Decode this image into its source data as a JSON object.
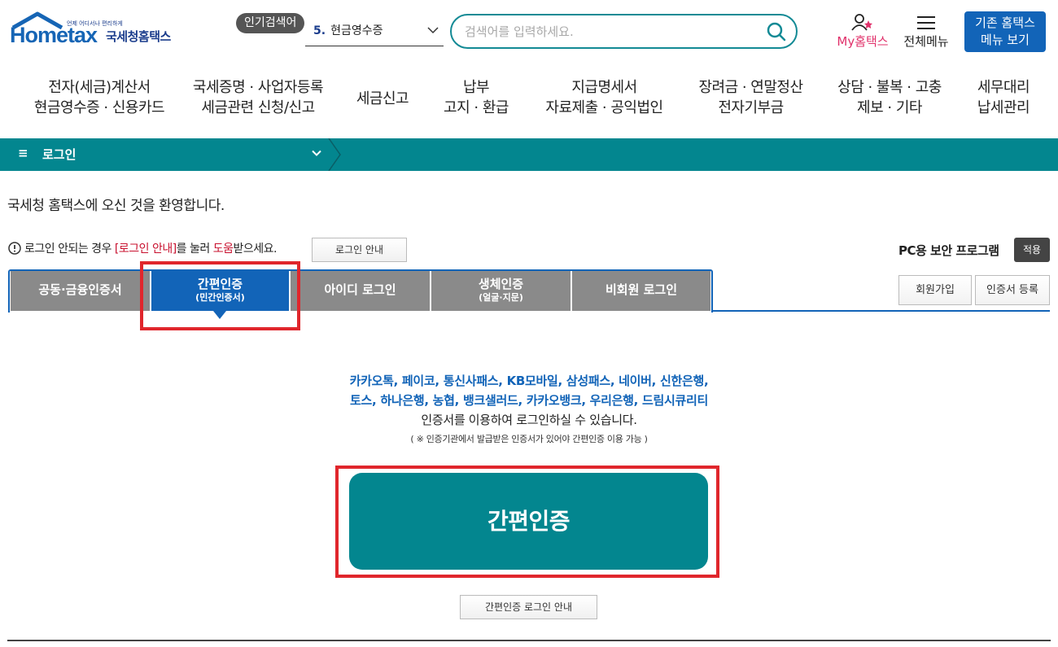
{
  "header": {
    "logo": {
      "tagline": "언제 어디서나 편리하게",
      "brand_en": "Hometax",
      "brand_ko": "국세청홈택스"
    },
    "popular": {
      "tag_label": "인기검색어",
      "rank": "5.",
      "keyword": "현금영수증"
    },
    "search": {
      "placeholder": "검색어를 입력하세요."
    },
    "my_hometax_label": "My홈택스",
    "all_menu_label": "전체메뉴",
    "old_menu_line1": "기존 홈택스",
    "old_menu_line2": "메뉴 보기"
  },
  "gnb": [
    {
      "line1": "전자(세금)계산서",
      "line2": "현금영수증 · 신용카드"
    },
    {
      "line1": "국세증명 · 사업자등록",
      "line2": "세금관련 신청/신고"
    },
    {
      "line1": "세금신고",
      "line2": ""
    },
    {
      "line1": "납부",
      "line2": "고지 · 환급"
    },
    {
      "line1": "지급명세서",
      "line2": "자료제출 · 공익법인"
    },
    {
      "line1": "장려금 · 연말정산",
      "line2": "전자기부금"
    },
    {
      "line1": "상담 · 불복 · 고충",
      "line2": "제보 · 기타"
    },
    {
      "line1": "세무대리",
      "line2": "납세관리"
    }
  ],
  "location": {
    "menu_icon_glyph": "≡",
    "label": "로그인"
  },
  "content": {
    "welcome": "국세청 홈택스에 오신 것을 환영합니다.",
    "notice_prefix": "로그인 안되는 경우 ",
    "notice_link": "[로그인 안내]",
    "notice_mid": "를 눌러 ",
    "notice_help": "도움",
    "notice_suffix": "받으세요.",
    "login_guide_button": "로그인 안내",
    "pc_security_label": "PC용 보안 프로그램",
    "apply_button": "적용"
  },
  "tabs": [
    {
      "label": "공동·금융인증서",
      "sub": ""
    },
    {
      "label": "간편인증",
      "sub": "(민간인증서)",
      "active": true
    },
    {
      "label": "아이디 로그인",
      "sub": ""
    },
    {
      "label": "생체인증",
      "sub": "(얼굴·지문)"
    },
    {
      "label": "비회원 로그인",
      "sub": ""
    }
  ],
  "side_buttons": {
    "signup": "회원가입",
    "cert_register": "인증서 등록"
  },
  "simple_auth": {
    "providers_line1": "카카오톡, 페이코, 통신사패스, KB모바일, 삼성패스, 네이버, 신한은행,",
    "providers_line2": "토스, 하나은행, 농협, 뱅크샐러드, 카카오뱅크, 우리은행, 드림시큐리티",
    "available_text": "인증서를 이용하여 로그인하실 수 있습니다.",
    "note": "( ※ 인증기관에서 발급받은 인증서가 있어야 간편인증 이용 가능 )",
    "main_button": "간편인증",
    "guide_button": "간편인증 로그인 안내"
  },
  "colors": {
    "primary_blue": "#1264b8",
    "teal": "#03868f",
    "highlight_red": "#e0262c",
    "my_pink": "#e0306a"
  }
}
